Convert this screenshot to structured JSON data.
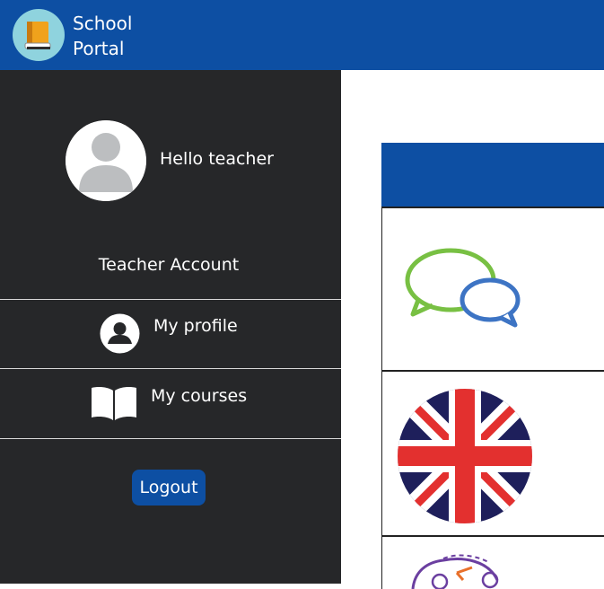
{
  "header": {
    "brand_line1": "School",
    "brand_line2": "Portal",
    "logo_icon": "book-icon",
    "background": "#0d4fa3"
  },
  "sidebar": {
    "greeting": "Hello teacher",
    "account_type": "Teacher Account",
    "background": "#262729",
    "items": [
      {
        "label": "My profile",
        "icon": "user-circle-icon"
      },
      {
        "label": "My courses",
        "icon": "open-book-icon"
      }
    ],
    "logout_label": "Logout"
  },
  "courses_table": {
    "header_color": "#0d4fa3",
    "rows": [
      {
        "icon": "speech-bubbles-icon"
      },
      {
        "icon": "uk-flag-icon"
      },
      {
        "icon": "people-exchange-icon"
      }
    ]
  }
}
